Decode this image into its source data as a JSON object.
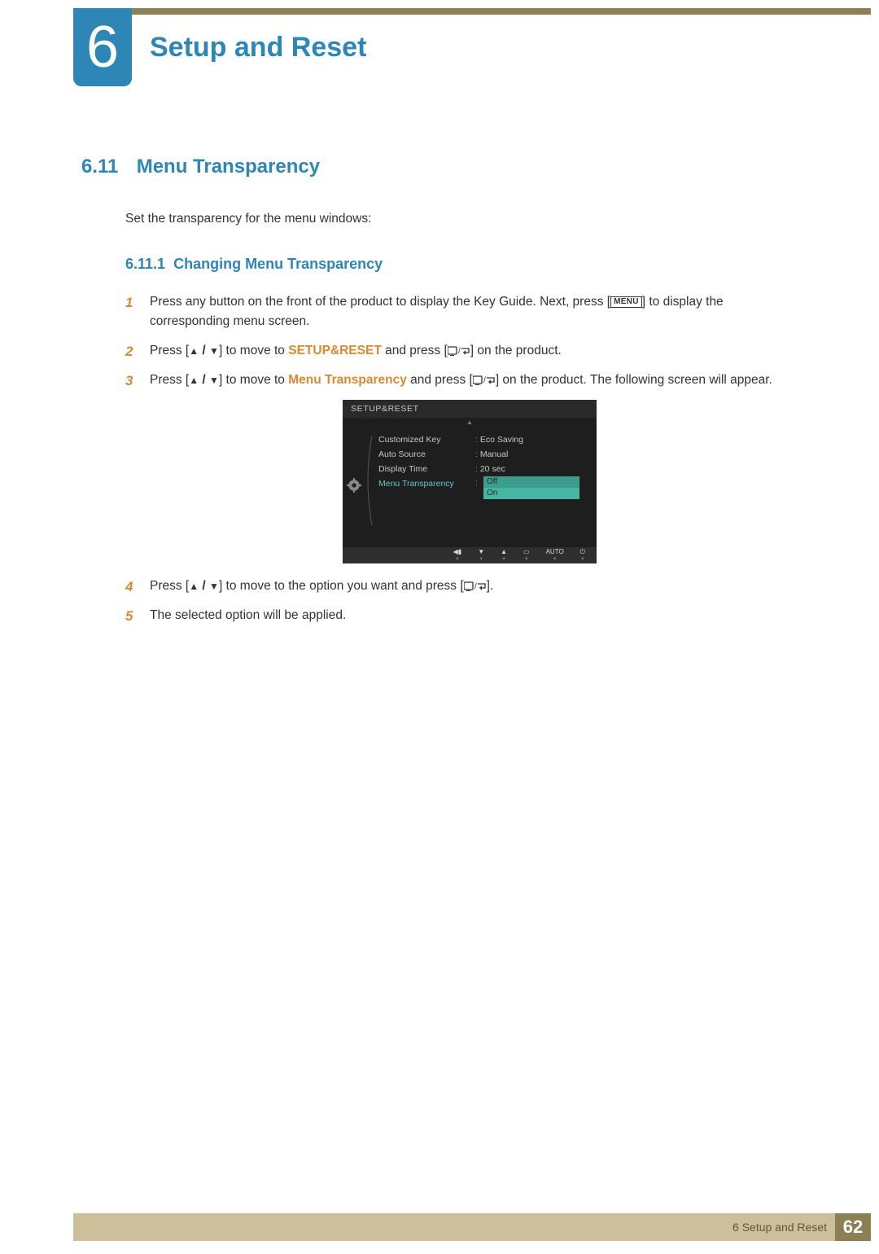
{
  "chapter": {
    "number": "6",
    "title": "Setup and Reset"
  },
  "section": {
    "number": "6.11",
    "title": "Menu Transparency",
    "intro": "Set the transparency for the menu windows:"
  },
  "subsection": {
    "number": "6.11.1",
    "title": "Changing Menu Transparency"
  },
  "steps": {
    "s1": {
      "num": "1",
      "pre": "Press any button on the front of the product to display the Key Guide. Next, press [",
      "key": "MENU",
      "post": "] to display the corresponding menu screen."
    },
    "s2": {
      "num": "2",
      "pre": "Press [",
      "mid": "] to move to ",
      "target": "SETUP&RESET",
      "aft": " and press [",
      "end": "] on the product."
    },
    "s3": {
      "num": "3",
      "pre": "Press [",
      "mid": "] to move to ",
      "target": "Menu Transparency",
      "aft": " and press [",
      "end": "] on the product. The following screen will appear."
    },
    "s4": {
      "num": "4",
      "pre": "Press [",
      "mid": "] to move to the option you want and press [",
      "end": "]."
    },
    "s5": {
      "num": "5",
      "text": "The selected option will be applied."
    }
  },
  "osd": {
    "title": "SETUP&RESET",
    "rows": [
      {
        "label": "Customized Key",
        "value": "Eco Saving"
      },
      {
        "label": "Auto Source",
        "value": "Manual"
      },
      {
        "label": "Display Time",
        "value": "20 sec"
      },
      {
        "label": "Menu Transparency",
        "value": "Off",
        "highlight": true
      }
    ],
    "dropdown": {
      "selected": "Off",
      "other": "On"
    },
    "footer_auto": "AUTO"
  },
  "footer": {
    "text": "6 Setup and Reset",
    "page": "62"
  }
}
